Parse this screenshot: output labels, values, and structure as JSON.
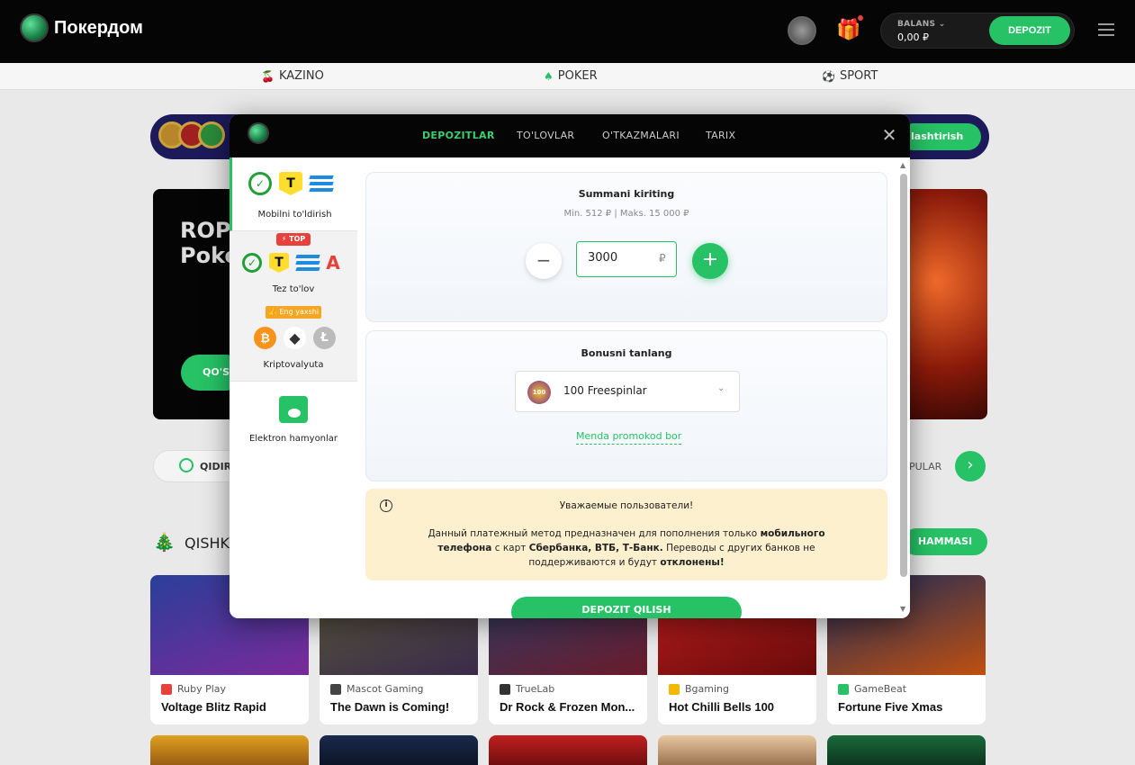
{
  "header": {
    "logo_text": "Покердом",
    "balance_label": "BALANS",
    "balance_value": "0,00 ₽",
    "deposit_label": "DEPOZIT"
  },
  "nav": {
    "items": [
      {
        "label": "KAZINO"
      },
      {
        "label": "POKER"
      },
      {
        "label": "SPORT"
      }
    ]
  },
  "background": {
    "strip_button": "lashtirish",
    "hero_title_1": "ROPI",
    "hero_title_2": "Poke",
    "hero_button": "QO'S",
    "search_label": "QIDIR",
    "popular_label": "PULAR",
    "section_title": "QISHK",
    "all_button": "HAMMASI",
    "games": [
      {
        "provider": "Ruby Play",
        "name": "Voltage Blitz Rapid",
        "color": "#2a3f9a"
      },
      {
        "provider": "Mascot Gaming",
        "name": "The Dawn is Coming!",
        "color": "#4a4a30"
      },
      {
        "provider": "TrueLab",
        "name": "Dr Rock & Frozen Mon...",
        "color": "#2a3f6a"
      },
      {
        "provider": "Bgaming",
        "name": "Hot Chilli Bells 100",
        "color": "#a01a1a"
      },
      {
        "provider": "GameBeat",
        "name": "Fortune Five Xmas",
        "color": "#1a2a5a"
      }
    ]
  },
  "modal": {
    "tabs": [
      {
        "label": "DEPOZITLAR",
        "active": true
      },
      {
        "label": "TO'LOVLAR",
        "active": false
      },
      {
        "label": "O'TKAZMALARI",
        "active": false
      },
      {
        "label": "TARIX",
        "active": false
      }
    ],
    "methods": [
      {
        "label": "Mobilni to'ldirish"
      },
      {
        "label": "Tez to'lov",
        "badge": "TOP"
      },
      {
        "label": "Kriptovalyuta",
        "badge": "Eng yaxshi"
      },
      {
        "label": "Elektron hamyonlar"
      }
    ],
    "amount": {
      "title": "Summani kiriting",
      "limits": "Min. 512 ₽ | Maks. 15 000 ₽",
      "value": "3000",
      "currency": "₽"
    },
    "bonus": {
      "title": "Bonusni tanlang",
      "selected": "100 Freespinlar",
      "icon_text": "100",
      "promo_link": "Menda promokod bor"
    },
    "notice": {
      "title": "Уважаемые пользователи!",
      "part1": "Данный платежный метод предназначен для пополнения только ",
      "bold1": "мобильного телефона",
      "part2": " с карт ",
      "bold2": "Сбербанка, ВТБ, Т-Банк.",
      "part3": " Переводы с других банков не поддерживаются и будут ",
      "bold3": "отклонены!"
    },
    "submit": "DEPOZIT QILISH"
  },
  "colors": {
    "accent": "#26c265",
    "notice_bg": "#fdf0cf",
    "header_bg": "#050505"
  }
}
